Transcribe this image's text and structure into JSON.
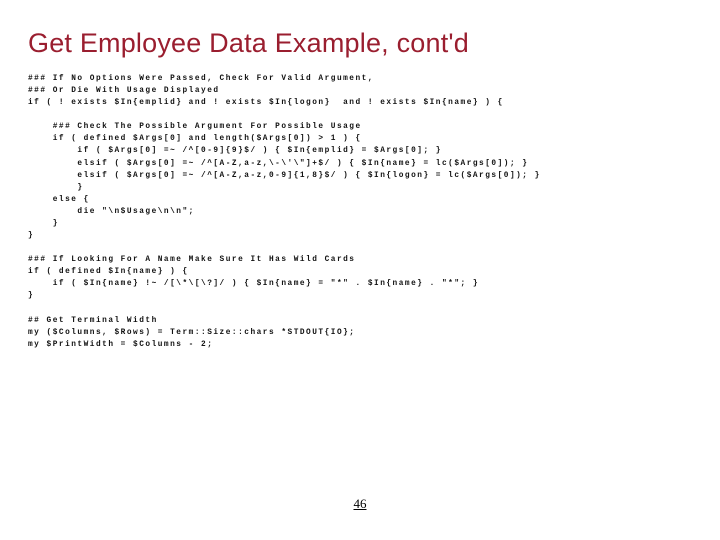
{
  "title": "Get Employee Data Example, cont'd",
  "code_lines": [
    "### If No Options Were Passed, Check For Valid Argument,",
    "### Or Die With Usage Displayed",
    "if ( ! exists $In{emplid} and ! exists $In{logon}  and ! exists $In{name} ) {",
    "",
    "    ### Check The Possible Argument For Possible Usage",
    "    if ( defined $Args[0] and length($Args[0]) > 1 ) {",
    "        if ( $Args[0] =~ /^[0-9]{9}$/ ) { $In{emplid} = $Args[0]; }",
    "        elsif ( $Args[0] =~ /^[A-Z,a-z,\\-\\'\\\"]+$/ ) { $In{name} = lc($Args[0]); }",
    "        elsif ( $Args[0] =~ /^[A-Z,a-z,0-9]{1,8}$/ ) { $In{logon} = lc($Args[0]); }",
    "        }",
    "    else {",
    "        die \"\\n$Usage\\n\\n\";",
    "    }",
    "}",
    "",
    "### If Looking For A Name Make Sure It Has Wild Cards",
    "if ( defined $In{name} ) {",
    "    if ( $In{name} !~ /[\\*\\[\\?]/ ) { $In{name} = \"*\" . $In{name} . \"*\"; }",
    "}",
    "",
    "## Get Terminal Width",
    "my ($Columns, $Rows) = Term::Size::chars *STDOUT{IO};",
    "my $PrintWidth = $Columns - 2;"
  ],
  "page_number": "46"
}
